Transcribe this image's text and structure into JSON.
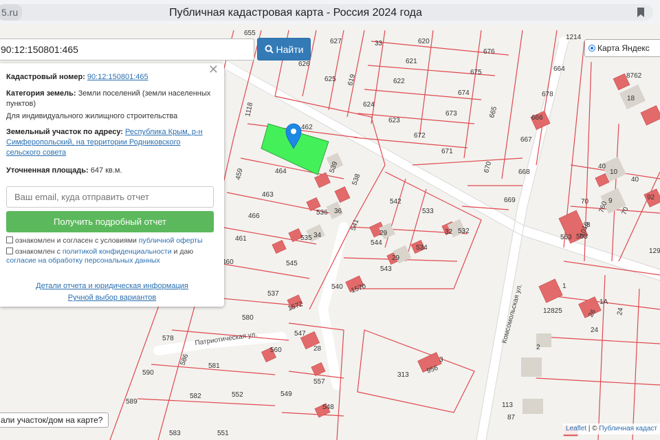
{
  "browser": {
    "url_fragment": "5.ru",
    "page_title": "Публичная кадастровая карта - Россия 2024 года"
  },
  "search": {
    "value": "90:12:150801:465",
    "button_label": "Найти"
  },
  "layer_control": {
    "label": "Карта Яндекс"
  },
  "info": {
    "cadastral_label": "Кадастровый номер:",
    "cadastral_value": "90:12:150801:465",
    "category_label": "Категория земель:",
    "category_value": "Земли поселений (земли населенных пунктов)",
    "usage": "Для индивидуального жилищного строительства",
    "address_label": "Земельный участок по адресу:",
    "address_value": "Республика Крым, р-н Симферопольский, на территории Родниковского сельского совета",
    "area_label": "Уточненная площадь:",
    "area_value": "647 кв.м.",
    "email_placeholder": "Ваш email, куда отправить отчет",
    "report_button": "Получить подробный отчет",
    "consent1_text": "ознакомлен и согласен с условиями",
    "consent1_link": "публичной оферты",
    "consent2_text": "ознакомлен с",
    "consent2_link1": "политикой конфиденциальности",
    "consent2_mid": "и даю",
    "consent2_link2": "согласие на обработку персональных данных",
    "details_link": "Детали отчета и юридическая информация",
    "manual_link": "Ручной выбор вариантов"
  },
  "bottom_left_button": "али участок/дом на карте?",
  "attribution": {
    "leaflet": "Leaflet",
    "sep": " | © ",
    "source": "Публичная кадаст"
  },
  "streets": {
    "patrioticheskaya": "Патриотическая ул.",
    "komsomolskaya": "Комсомольская ул."
  },
  "parcel_labels": [
    "655",
    "627",
    "33",
    "620",
    "676",
    "1214",
    "626",
    "625",
    "619",
    "621",
    "675",
    "664",
    "622",
    "674",
    "678",
    "624",
    "665",
    "673",
    "666",
    "1118",
    "462",
    "623",
    "672",
    "667",
    "671",
    "670",
    "668",
    "539",
    "464",
    "538",
    "542",
    "533",
    "669",
    "459",
    "463",
    "536",
    "36",
    "532",
    "466",
    "541",
    "29",
    "544",
    "32",
    "461",
    "535",
    "34",
    "534",
    "563",
    "545",
    "29",
    "543",
    "460",
    "540",
    "1570",
    "537",
    "1572",
    "580",
    "547",
    "578",
    "28",
    "560",
    "586",
    "581",
    "590",
    "3",
    "313",
    "956",
    "582",
    "552",
    "557",
    "549",
    "589",
    "548",
    "583",
    "551",
    "8762",
    "18",
    "40",
    "10",
    "40",
    "70",
    "9",
    "760",
    "70",
    "92",
    "1016",
    "8",
    "563",
    "129",
    "1",
    "1A",
    "12825",
    "26",
    "24",
    "24",
    "2",
    "113",
    "87"
  ],
  "colors": {
    "highlight": "#44f05a",
    "parcel_line": "#e0484e",
    "building": "#e36a6a",
    "marker": "#1e88e5"
  }
}
